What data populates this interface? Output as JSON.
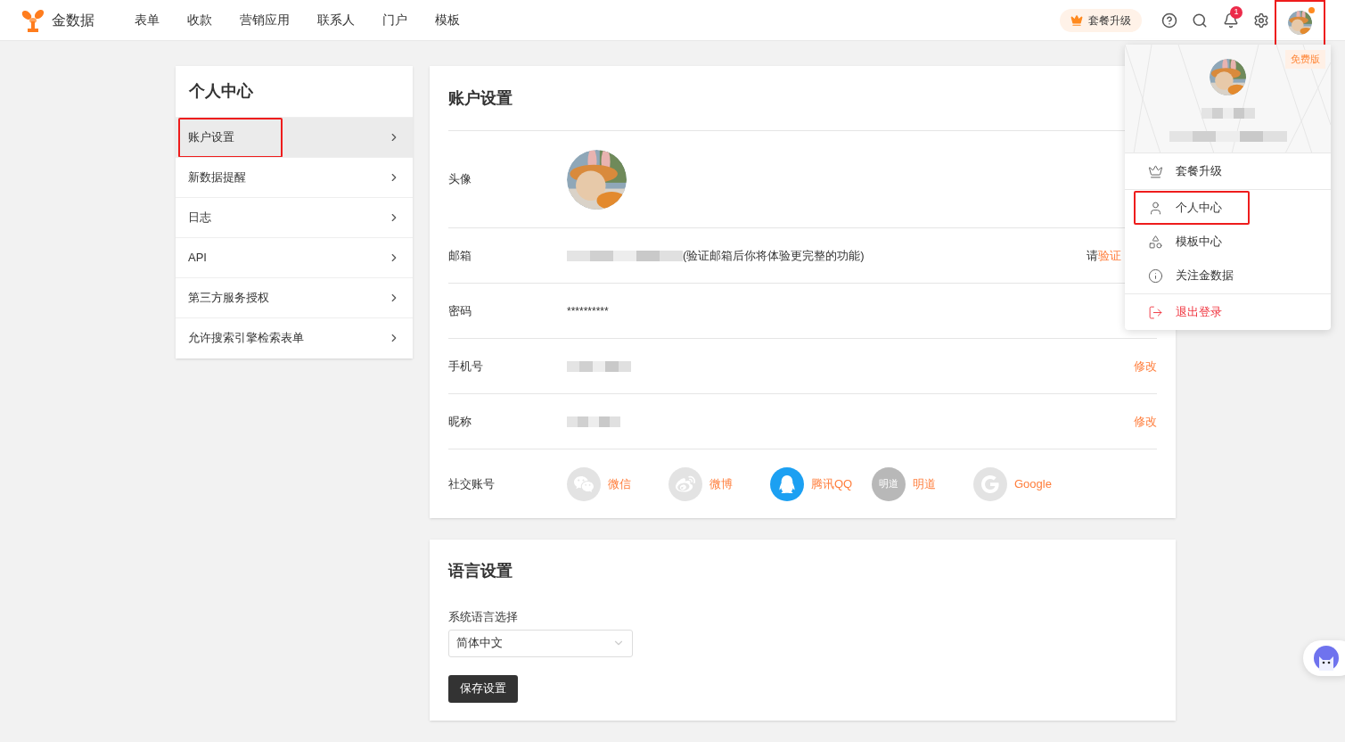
{
  "brand": {
    "name": "金数据"
  },
  "nav": [
    "表单",
    "收款",
    "营销应用",
    "联系人",
    "门户",
    "模板"
  ],
  "header": {
    "upgrade": "套餐升级",
    "notifications": "1",
    "avatar_highlighted": true,
    "avatar_dot": true
  },
  "sidebar": {
    "title": "个人中心",
    "items": [
      {
        "label": "账户设置",
        "selected": true,
        "highlighted": true
      },
      {
        "label": "新数据提醒",
        "selected": false,
        "highlighted": false
      },
      {
        "label": "日志",
        "selected": false,
        "highlighted": false
      },
      {
        "label": "API",
        "selected": false,
        "highlighted": false
      },
      {
        "label": "第三方服务授权",
        "selected": false,
        "highlighted": false
      },
      {
        "label": "允许搜索引擎检索表单",
        "selected": false,
        "highlighted": false
      }
    ]
  },
  "account": {
    "title": "账户设置",
    "rows": [
      {
        "kind": "avatar",
        "label": "头像"
      },
      {
        "kind": "email",
        "label": "邮箱",
        "note": "(验证邮箱后你将体验更完整的功能)",
        "action_prefix": "请",
        "action": "验证"
      },
      {
        "kind": "password",
        "label": "密码",
        "value": "**********"
      },
      {
        "kind": "phone",
        "label": "手机号",
        "action": "修改"
      },
      {
        "kind": "nickname",
        "label": "昵称",
        "action": "修改"
      },
      {
        "kind": "social",
        "label": "社交账号",
        "accounts": [
          {
            "kind": "wechat",
            "label": "微信",
            "bound": false
          },
          {
            "kind": "weibo",
            "label": "微博",
            "bound": false
          },
          {
            "kind": "qq",
            "label": "腾讯QQ",
            "bound": true
          },
          {
            "kind": "mingdao",
            "label": "明道",
            "logo_text": "明道",
            "bound": false
          },
          {
            "kind": "google",
            "label": "Google",
            "bound": false
          }
        ]
      }
    ]
  },
  "language": {
    "title": "语言设置",
    "label": "系统语言选择",
    "value": "简体中文",
    "save": "保存设置"
  },
  "menu": {
    "plan": "免费版",
    "groups": [
      [
        {
          "kind": "upgrade",
          "label": "套餐升级",
          "highlighted": false
        }
      ],
      [
        {
          "kind": "profile",
          "label": "个人中心",
          "highlighted": true
        },
        {
          "kind": "templates",
          "label": "模板中心",
          "highlighted": false
        },
        {
          "kind": "about",
          "label": "关注金数据",
          "highlighted": false
        }
      ],
      [
        {
          "kind": "logout",
          "label": "退出登录",
          "highlighted": false
        }
      ]
    ]
  }
}
